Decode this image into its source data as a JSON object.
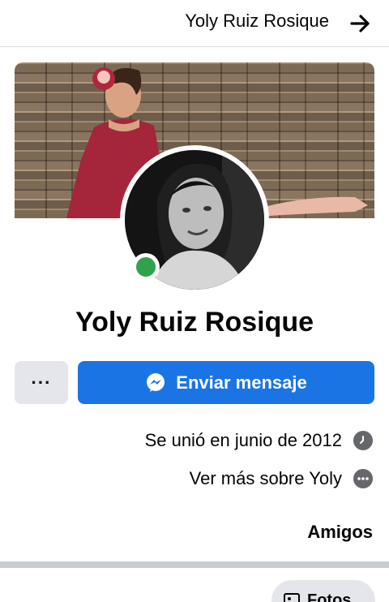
{
  "header": {
    "title": "Yoly Ruiz Rosique",
    "back_icon": "arrow-right-icon"
  },
  "profile": {
    "name": "Yoly Ruiz Rosique",
    "status": "online"
  },
  "actions": {
    "message_label": "Enviar mensaje",
    "more_label": "···"
  },
  "info": {
    "joined": "Se unió en junio de 2012",
    "see_more": "Ver más sobre Yoly"
  },
  "sections": {
    "friends_title": "Amigos",
    "photos_label": "Fotos"
  },
  "colors": {
    "primary": "#1b74e4",
    "online": "#31a24c",
    "secondary_button": "#e4e6eb"
  }
}
